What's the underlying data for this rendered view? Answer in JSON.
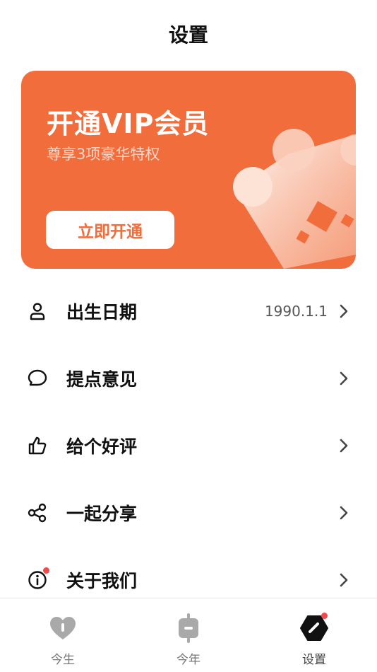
{
  "header": {
    "title": "设置"
  },
  "vip": {
    "title": "开通VIP会员",
    "subtitle": "尊享3项豪华特权",
    "button_label": "立即开通",
    "accent": "#f16d3b"
  },
  "menu": {
    "items": [
      {
        "label": "出生日期",
        "value": "1990.1.1",
        "icon": "person-icon"
      },
      {
        "label": "提点意见",
        "icon": "chat-bubble-icon"
      },
      {
        "label": "给个好评",
        "icon": "thumbs-up-icon"
      },
      {
        "label": "一起分享",
        "icon": "share-icon"
      },
      {
        "label": "关于我们",
        "icon": "info-icon",
        "badge_color": "#f24a4a"
      }
    ]
  },
  "tabbar": {
    "tabs": [
      {
        "label": "今生",
        "icon": "heart-icon",
        "color": "#aaaaaa"
      },
      {
        "label": "今年",
        "icon": "calendar-tile-icon",
        "color": "#aaaaaa"
      },
      {
        "label": "设置",
        "icon": "settings-hexagon-icon",
        "color": "#111111",
        "active": true
      }
    ]
  }
}
